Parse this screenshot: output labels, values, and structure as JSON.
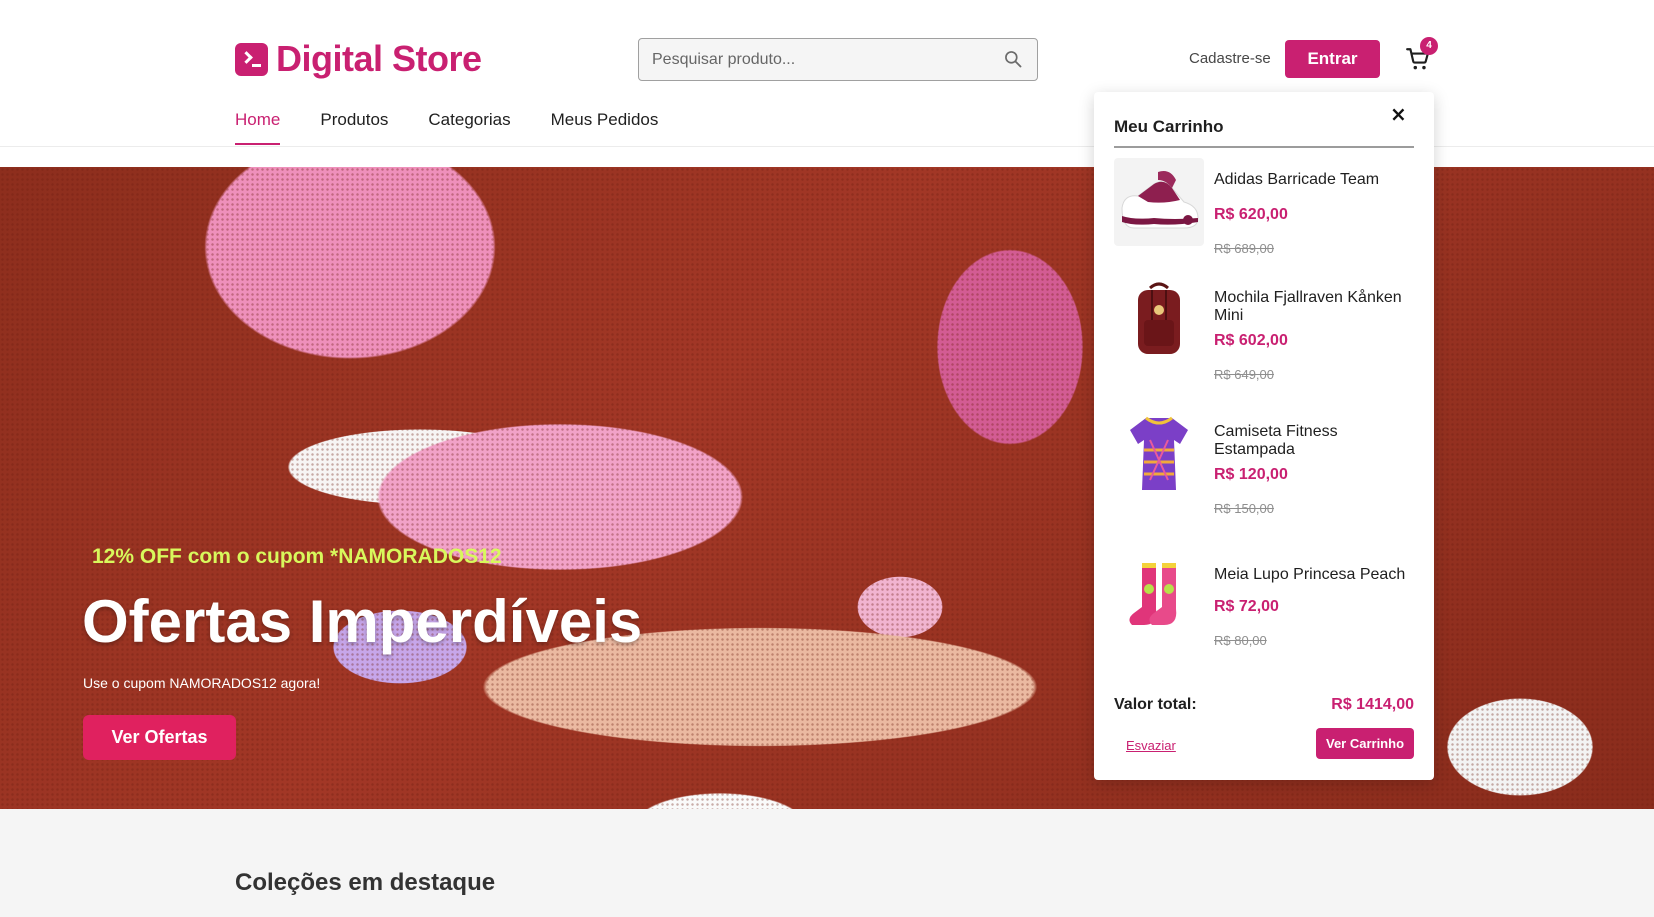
{
  "brand": {
    "name": "Digital Store",
    "accent": "#c92071"
  },
  "search": {
    "placeholder": "Pesquisar produto...",
    "value": ""
  },
  "header": {
    "signup_label": "Cadastre-se",
    "login_label": "Entrar",
    "cart_count": "4"
  },
  "nav": {
    "items": [
      {
        "label": "Home",
        "active": true
      },
      {
        "label": "Produtos",
        "active": false
      },
      {
        "label": "Categorias",
        "active": false
      },
      {
        "label": "Meus Pedidos",
        "active": false
      }
    ]
  },
  "hero": {
    "promo": "12% OFF com o cupom *NAMORADOS12",
    "title": "Ofertas Imperdíveis",
    "subtitle": "Use o cupom NAMORADOS12 agora!",
    "cta_label": "Ver Ofertas"
  },
  "cart": {
    "title": "Meu Carrinho",
    "items": [
      {
        "name": "Adidas Barricade Team",
        "price": "R$ 620,00",
        "old_price": "R$ 689,00"
      },
      {
        "name": "Mochila Fjallraven Kånken Mini",
        "price": "R$ 602,00",
        "old_price": "R$ 649,00"
      },
      {
        "name": "Camiseta Fitness Estampada",
        "price": "R$ 120,00",
        "old_price": "R$ 150,00"
      },
      {
        "name": "Meia Lupo Princesa Peach",
        "price": "R$ 72,00",
        "old_price": "R$ 80,00"
      }
    ],
    "total_label": "Valor total:",
    "total_value": "R$ 1414,00",
    "empty_label": "Esvaziar",
    "view_label": "Ver Carrinho"
  },
  "collections": {
    "title": "Coleções em destaque"
  }
}
